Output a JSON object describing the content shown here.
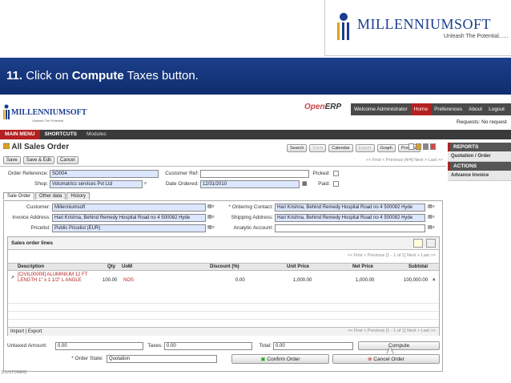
{
  "slide": {
    "step_number": "11.",
    "step_pre": " Click on ",
    "step_bold": "Compute",
    "step_post": " Taxes button.",
    "logo_brand": "MILLENNIUMSOFT",
    "logo_tagline": "Unleash The Potential......"
  },
  "app": {
    "brand": "MILLENNIUMSOFT",
    "brand_sub": "Unleash The Potential",
    "product_name_a": "Open",
    "product_name_b": "ERP",
    "welcome": "Welcome Administrator",
    "top_links": [
      "Home",
      "Preferences",
      "About",
      "Logout"
    ],
    "requests": "Requests: No request",
    "menu": {
      "main": "MAIN MENU",
      "shortcuts": "SHORTCUTS",
      "modules": "Modules"
    },
    "sidebar": {
      "reports_head": "REPORTS",
      "reports_item": "Quotation / Order",
      "actions_head": "ACTIONS",
      "actions_item": "Advance Invoice"
    },
    "page_title": "All Sales Order",
    "view_buttons": [
      "Search",
      "Form",
      "Calendar",
      "Export",
      "Graph",
      "Process"
    ],
    "form_buttons": {
      "save": "Save",
      "save_edit": "Save & Edit",
      "cancel": "Cancel"
    },
    "form_pager": "<< First < Previous [4/4] Next > Last >>",
    "fields": {
      "order_ref_label": "Order Reference:",
      "order_ref": "SO004",
      "customer_ref_label": "Customer Ref:",
      "customer_ref": "",
      "picked_label": "Picked:",
      "shop_label": "Shop:",
      "shop": "Volumatrics services Pvt Ltd",
      "date_label": "Date Ordered:",
      "date": "12/31/2010",
      "paid_label": "Paid:"
    },
    "tabs": [
      "Sale Order",
      "Other data",
      "History"
    ],
    "order": {
      "customer_label": "Customer:",
      "customer": "Millenniumsoft",
      "ordering_label": "* Ordering Contact:",
      "ordering": "Hari Krishna, Behind Remedy Hospital Road no 4 500082 Hyde",
      "invoice_label": "Invoice Address:",
      "invoice": "Hari Krishna, Behind Remedy Hospital Road no 4 500082 Hyde",
      "shipping_label": "Shipping Address:",
      "shipping": "Hari Krishna, Behind Remedy Hospital Road no 4 500082 Hyde",
      "pricelist_label": "Pricelist:",
      "pricelist": "Public Pricelist (EUR)",
      "analytic_label": "Analytic Account:",
      "analytic": ""
    },
    "lines": {
      "title": "Sales order lines",
      "pager": "<< First < Previous [1 - 1 of 1] Next > Last >>",
      "headers": [
        "Description",
        "Qty",
        "UoM",
        "Discount (%)",
        "Unit Price",
        "Net Price",
        "Subtotal"
      ],
      "row": {
        "desc": "[CIVIL00009] ALUMINIUM 12 FT LENGTH 1\" x 1 1/2\" L ANGLE",
        "qty": "100.00",
        "uom": "NOS",
        "discount": "0.00",
        "unit_price": "1,000.00",
        "net_price": "1,000.00",
        "subtotal": "100,000.00"
      },
      "footer": "Import | Export"
    },
    "totals": {
      "untaxed_label": "Untaxed Amount:",
      "untaxed": "0.00",
      "taxes_label": "Taxes:",
      "taxes": "0.00",
      "total_label": "Total:",
      "total": "0.00",
      "compute": "Compute",
      "state_label": "* Order State:",
      "state": "Quotation",
      "confirm": "Confirm Order",
      "cancel_order": "Cancel Order"
    },
    "status": "[CUSTOMER]"
  }
}
